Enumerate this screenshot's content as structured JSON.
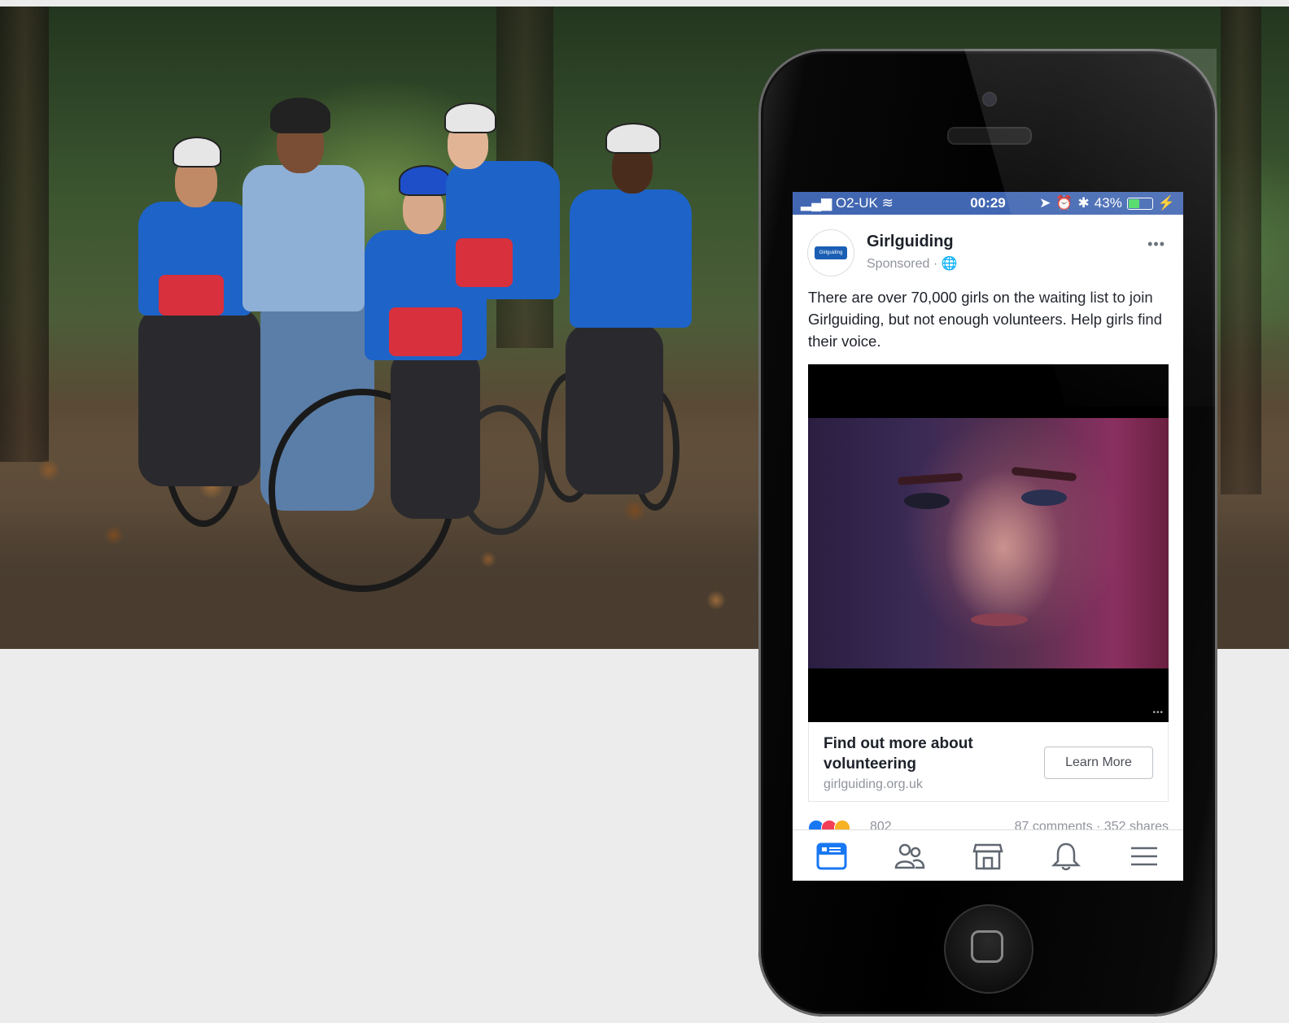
{
  "status_bar": {
    "carrier": "O2-UK",
    "time": "00:29",
    "battery": "43%",
    "battery_level": 0.43
  },
  "post": {
    "page_name": "Girlguiding",
    "sponsored": "Sponsored · ",
    "text": "There are over 70,000 girls on the waiting list to join Girlguiding, but not enough volunteers. Help girls find their voice.",
    "cta_title": "Find out more about volunteering",
    "cta_domain": "girlguiding.org.uk",
    "cta_button": "Learn More",
    "reactions_count": "802",
    "comments_shares": "87 comments · 352 shares",
    "avatar_logo_text": "Girlguiding"
  },
  "tabs": [
    {
      "name": "news-feed",
      "icon": "news-feed-icon",
      "active": true
    },
    {
      "name": "friends",
      "icon": "friends-icon",
      "active": false
    },
    {
      "name": "marketplace",
      "icon": "marketplace-icon",
      "active": false
    },
    {
      "name": "notifications",
      "icon": "bell-icon",
      "active": false
    },
    {
      "name": "menu",
      "icon": "hamburger-icon",
      "active": false
    }
  ],
  "colors": {
    "facebook_blue": "#4267b2",
    "active_tab": "#1877f2",
    "guide_blue": "#1a5fb4",
    "guide_red": "#d8303c"
  }
}
